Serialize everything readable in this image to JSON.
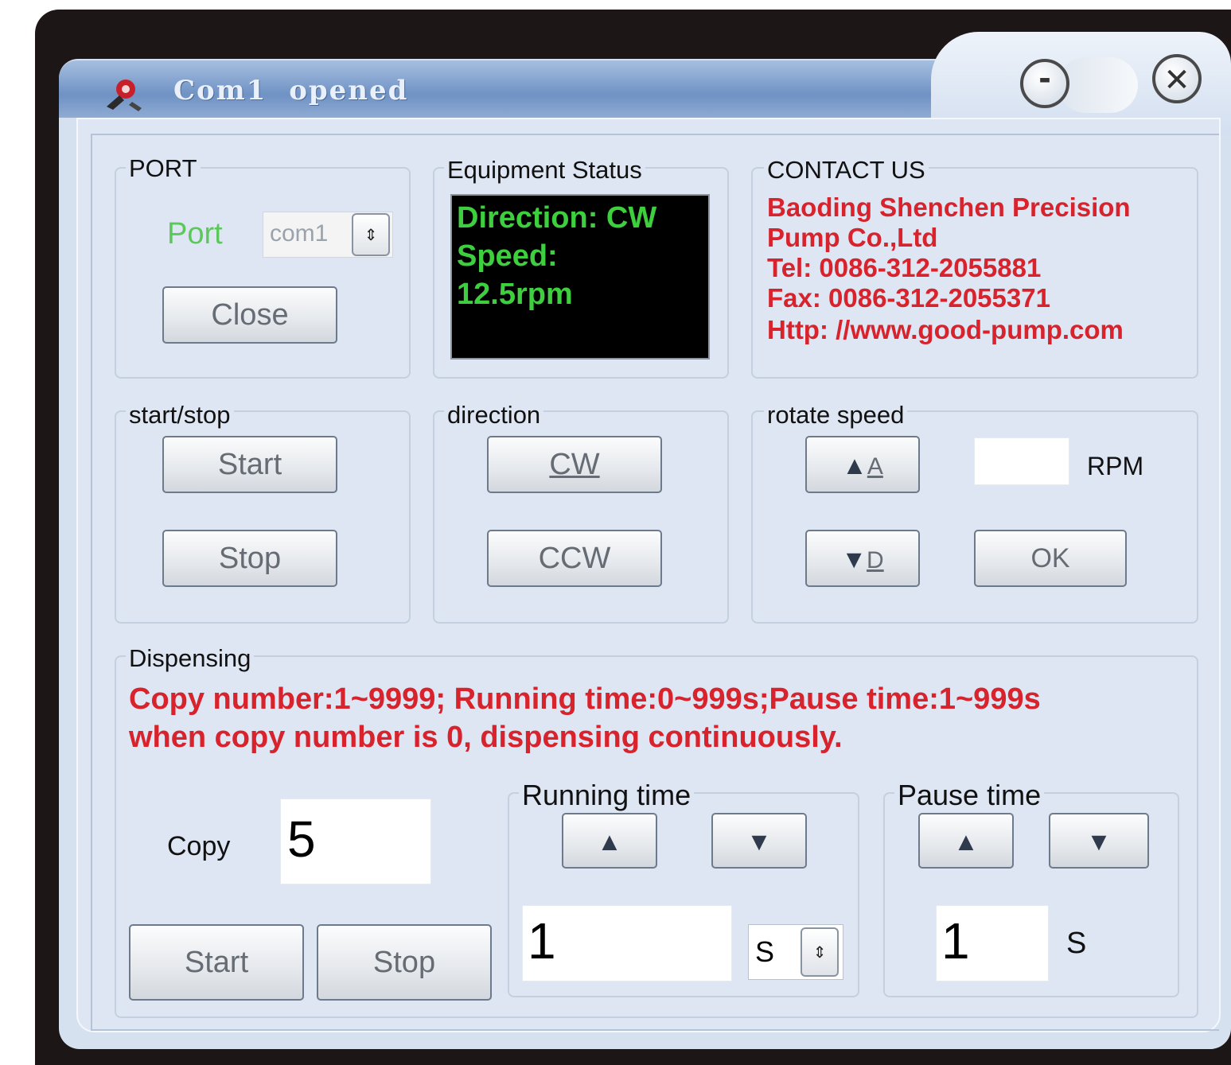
{
  "window": {
    "title": "Com1 opened",
    "minimize_label": "-",
    "close_label": "✕"
  },
  "port": {
    "group_label": "PORT",
    "port_label": "Port",
    "port_value": "com1",
    "close_button": "Close"
  },
  "equipment_status": {
    "group_label": "Equipment Status",
    "line1": "Direction: CW",
    "line2": "Speed:",
    "line3": "12.5rpm"
  },
  "contact": {
    "group_label": "CONTACT US",
    "lines": [
      "Baoding Shenchen Precision",
      "Pump Co.,Ltd",
      "Tel: 0086-312-2055881",
      "Fax: 0086-312-2055371",
      "Http: //www.good-pump.com"
    ]
  },
  "start_stop": {
    "group_label": "start/stop",
    "start_button": "Start",
    "stop_button": "Stop"
  },
  "direction": {
    "group_label": "direction",
    "cw_button": "CW",
    "ccw_button": "CCW"
  },
  "rotate_speed": {
    "group_label": "rotate speed",
    "up_button": "A",
    "down_button": "D",
    "rpm_value": "",
    "rpm_unit": "RPM",
    "ok_button": "OK"
  },
  "dispensing": {
    "group_label": "Dispensing",
    "notice_line1": "Copy number:1~9999; Running time:0~999s;Pause time:1~999s",
    "notice_line2": "when copy number is 0, dispensing continuously.",
    "copy_label": "Copy",
    "copy_value": "5",
    "start_button": "Start",
    "stop_button": "Stop",
    "running_time": {
      "group_label": "Running time",
      "value": "1",
      "unit_value": "S"
    },
    "pause_time": {
      "group_label": "Pause time",
      "value": "1",
      "unit": "S"
    }
  }
}
